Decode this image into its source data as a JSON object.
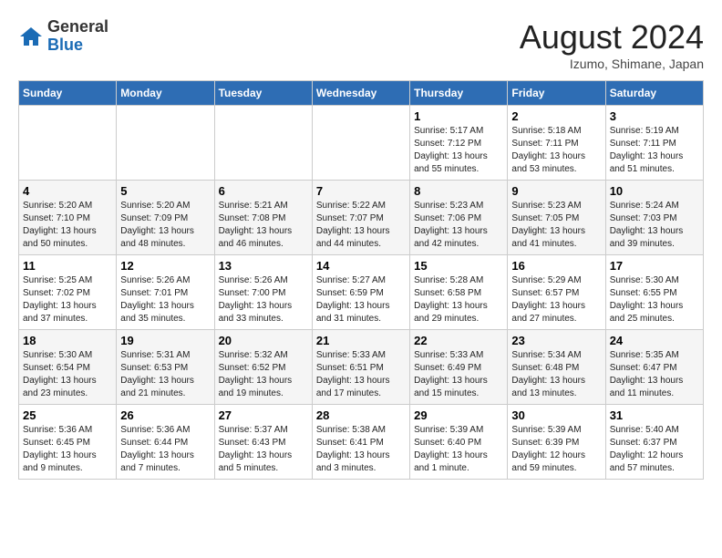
{
  "logo": {
    "general": "General",
    "blue": "Blue"
  },
  "title": "August 2024",
  "location": "Izumo, Shimane, Japan",
  "weekdays": [
    "Sunday",
    "Monday",
    "Tuesday",
    "Wednesday",
    "Thursday",
    "Friday",
    "Saturday"
  ],
  "weeks": [
    [
      {
        "day": "",
        "info": ""
      },
      {
        "day": "",
        "info": ""
      },
      {
        "day": "",
        "info": ""
      },
      {
        "day": "",
        "info": ""
      },
      {
        "day": "1",
        "info": "Sunrise: 5:17 AM\nSunset: 7:12 PM\nDaylight: 13 hours\nand 55 minutes."
      },
      {
        "day": "2",
        "info": "Sunrise: 5:18 AM\nSunset: 7:11 PM\nDaylight: 13 hours\nand 53 minutes."
      },
      {
        "day": "3",
        "info": "Sunrise: 5:19 AM\nSunset: 7:11 PM\nDaylight: 13 hours\nand 51 minutes."
      }
    ],
    [
      {
        "day": "4",
        "info": "Sunrise: 5:20 AM\nSunset: 7:10 PM\nDaylight: 13 hours\nand 50 minutes."
      },
      {
        "day": "5",
        "info": "Sunrise: 5:20 AM\nSunset: 7:09 PM\nDaylight: 13 hours\nand 48 minutes."
      },
      {
        "day": "6",
        "info": "Sunrise: 5:21 AM\nSunset: 7:08 PM\nDaylight: 13 hours\nand 46 minutes."
      },
      {
        "day": "7",
        "info": "Sunrise: 5:22 AM\nSunset: 7:07 PM\nDaylight: 13 hours\nand 44 minutes."
      },
      {
        "day": "8",
        "info": "Sunrise: 5:23 AM\nSunset: 7:06 PM\nDaylight: 13 hours\nand 42 minutes."
      },
      {
        "day": "9",
        "info": "Sunrise: 5:23 AM\nSunset: 7:05 PM\nDaylight: 13 hours\nand 41 minutes."
      },
      {
        "day": "10",
        "info": "Sunrise: 5:24 AM\nSunset: 7:03 PM\nDaylight: 13 hours\nand 39 minutes."
      }
    ],
    [
      {
        "day": "11",
        "info": "Sunrise: 5:25 AM\nSunset: 7:02 PM\nDaylight: 13 hours\nand 37 minutes."
      },
      {
        "day": "12",
        "info": "Sunrise: 5:26 AM\nSunset: 7:01 PM\nDaylight: 13 hours\nand 35 minutes."
      },
      {
        "day": "13",
        "info": "Sunrise: 5:26 AM\nSunset: 7:00 PM\nDaylight: 13 hours\nand 33 minutes."
      },
      {
        "day": "14",
        "info": "Sunrise: 5:27 AM\nSunset: 6:59 PM\nDaylight: 13 hours\nand 31 minutes."
      },
      {
        "day": "15",
        "info": "Sunrise: 5:28 AM\nSunset: 6:58 PM\nDaylight: 13 hours\nand 29 minutes."
      },
      {
        "day": "16",
        "info": "Sunrise: 5:29 AM\nSunset: 6:57 PM\nDaylight: 13 hours\nand 27 minutes."
      },
      {
        "day": "17",
        "info": "Sunrise: 5:30 AM\nSunset: 6:55 PM\nDaylight: 13 hours\nand 25 minutes."
      }
    ],
    [
      {
        "day": "18",
        "info": "Sunrise: 5:30 AM\nSunset: 6:54 PM\nDaylight: 13 hours\nand 23 minutes."
      },
      {
        "day": "19",
        "info": "Sunrise: 5:31 AM\nSunset: 6:53 PM\nDaylight: 13 hours\nand 21 minutes."
      },
      {
        "day": "20",
        "info": "Sunrise: 5:32 AM\nSunset: 6:52 PM\nDaylight: 13 hours\nand 19 minutes."
      },
      {
        "day": "21",
        "info": "Sunrise: 5:33 AM\nSunset: 6:51 PM\nDaylight: 13 hours\nand 17 minutes."
      },
      {
        "day": "22",
        "info": "Sunrise: 5:33 AM\nSunset: 6:49 PM\nDaylight: 13 hours\nand 15 minutes."
      },
      {
        "day": "23",
        "info": "Sunrise: 5:34 AM\nSunset: 6:48 PM\nDaylight: 13 hours\nand 13 minutes."
      },
      {
        "day": "24",
        "info": "Sunrise: 5:35 AM\nSunset: 6:47 PM\nDaylight: 13 hours\nand 11 minutes."
      }
    ],
    [
      {
        "day": "25",
        "info": "Sunrise: 5:36 AM\nSunset: 6:45 PM\nDaylight: 13 hours\nand 9 minutes."
      },
      {
        "day": "26",
        "info": "Sunrise: 5:36 AM\nSunset: 6:44 PM\nDaylight: 13 hours\nand 7 minutes."
      },
      {
        "day": "27",
        "info": "Sunrise: 5:37 AM\nSunset: 6:43 PM\nDaylight: 13 hours\nand 5 minutes."
      },
      {
        "day": "28",
        "info": "Sunrise: 5:38 AM\nSunset: 6:41 PM\nDaylight: 13 hours\nand 3 minutes."
      },
      {
        "day": "29",
        "info": "Sunrise: 5:39 AM\nSunset: 6:40 PM\nDaylight: 13 hours\nand 1 minute."
      },
      {
        "day": "30",
        "info": "Sunrise: 5:39 AM\nSunset: 6:39 PM\nDaylight: 12 hours\nand 59 minutes."
      },
      {
        "day": "31",
        "info": "Sunrise: 5:40 AM\nSunset: 6:37 PM\nDaylight: 12 hours\nand 57 minutes."
      }
    ]
  ]
}
